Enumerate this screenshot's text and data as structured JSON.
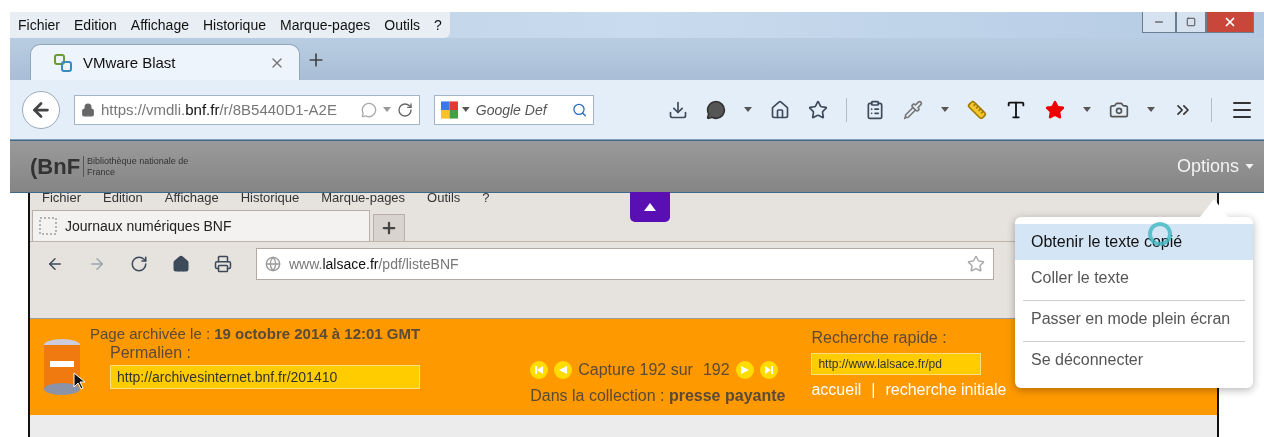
{
  "outer_menu": [
    "Fichier",
    "Edition",
    "Affichage",
    "Historique",
    "Marque-pages",
    "Outils",
    "?"
  ],
  "outer_tab": {
    "label": "VMware Blast",
    "selected": true
  },
  "outer_address": "https://vmdli.**bnf.fr**/r/8B5440D1-A2E",
  "outer_search": {
    "placeholder": "Google Def"
  },
  "bnf_header": {
    "logo": "(BnF",
    "logo_sub": "Bibliothèque nationale de France",
    "options": "Options"
  },
  "inner_menu": [
    "Fichier",
    "Edition",
    "Affichage",
    "Historique",
    "Marque-pages",
    "Outils",
    "?"
  ],
  "inner_tab": {
    "label": "Journaux numériques BNF",
    "selected": true
  },
  "inner_address": "www.**lalsace.fr**/pdf/listeBNF",
  "archive_bar": {
    "archived": "Page archivée le : **19 octobre 2014 à 12:01 GMT**",
    "permalink_label": "Permalien :",
    "permalink_value": "http://archivesinternet.bnf.fr/201410",
    "capture": "Capture 192 sur",
    "capture_total": "192",
    "collection": "Dans la collection : **presse payante**",
    "quick_search_label": "Recherche rapide :",
    "quick_search_value": "http://www.lalsace.fr/pd",
    "links": [
      "accueil",
      "recherche initiale"
    ],
    "link_separator": "|"
  },
  "options_menu": [
    {
      "label": "Obtenir le texte copié",
      "selected": true,
      "separated": false
    },
    {
      "label": "Coller le texte",
      "selected": false,
      "separated": false
    },
    {
      "label": "Passer en mode plein écran",
      "selected": false,
      "separated": true
    },
    {
      "label": "Se déconnecter",
      "selected": false,
      "separated": true
    }
  ]
}
